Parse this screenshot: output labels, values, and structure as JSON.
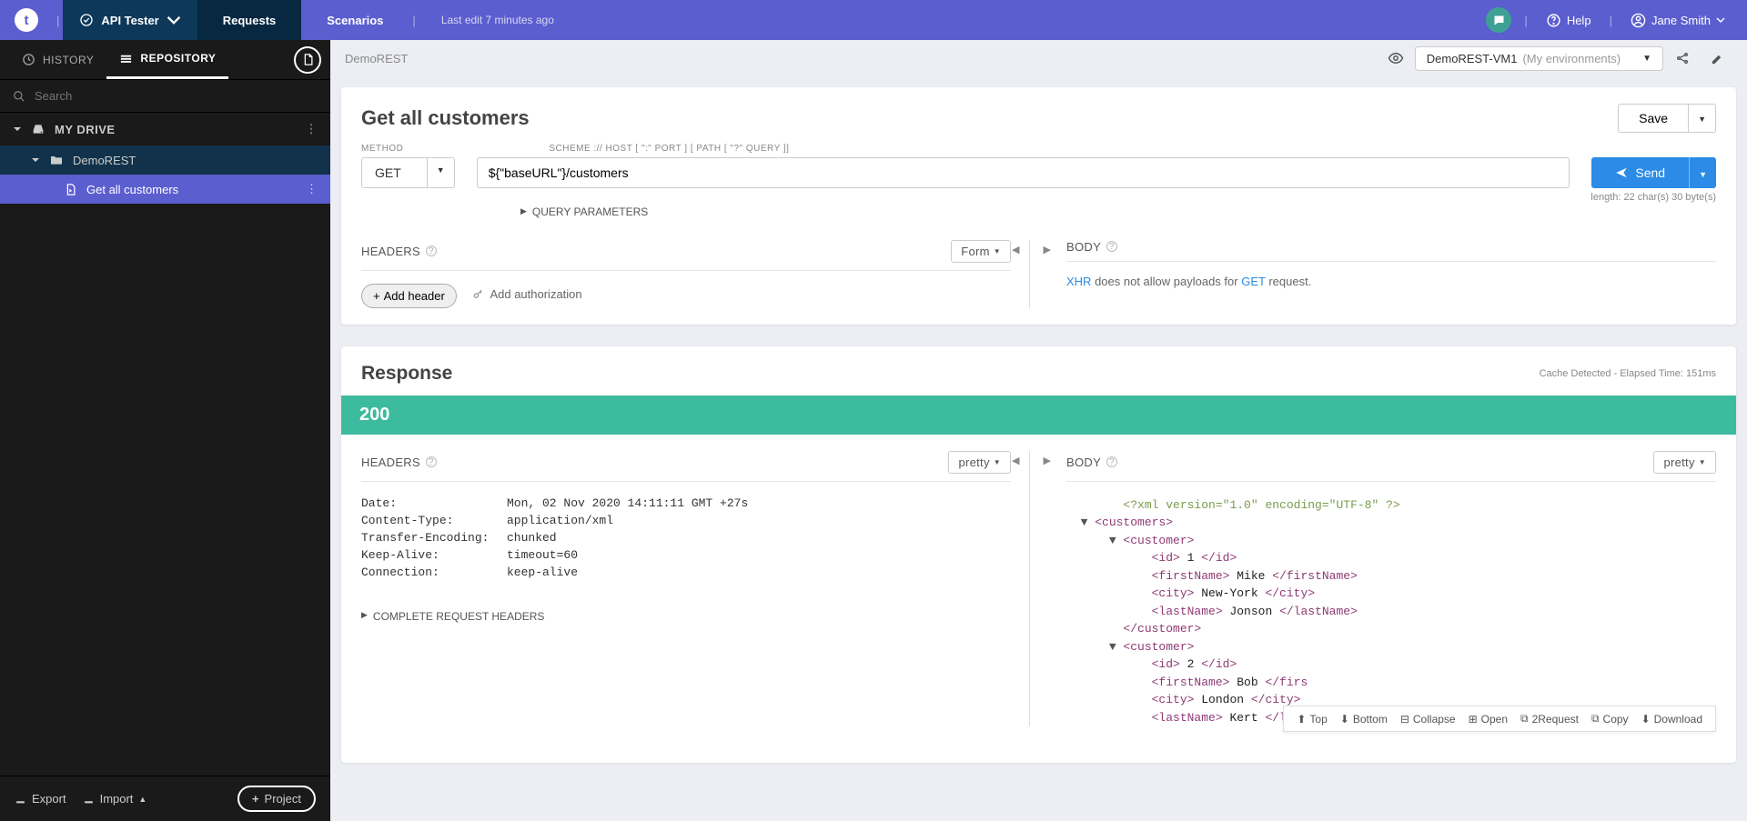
{
  "topbar": {
    "logo_letter": "t",
    "app_name": "API Tester",
    "tabs": {
      "requests": "Requests",
      "scenarios": "Scenarios"
    },
    "last_edit": "Last edit 7 minutes ago",
    "help": "Help",
    "user": "Jane Smith"
  },
  "sidebar": {
    "tabs": {
      "history": "HISTORY",
      "repository": "REPOSITORY"
    },
    "search_placeholder": "Search",
    "drive": "MY DRIVE",
    "project": "DemoREST",
    "request": "Get all customers",
    "footer": {
      "export": "Export",
      "import": "Import",
      "project": "Project"
    }
  },
  "main": {
    "breadcrumb": "DemoREST",
    "env": {
      "name": "DemoREST-VM1",
      "group": "(My environments)"
    }
  },
  "request": {
    "title": "Get all customers",
    "save": "Save",
    "labels": {
      "method": "METHOD",
      "scheme": "SCHEME :// HOST [ \":\" PORT ] [ PATH [ \"?\" QUERY ]]"
    },
    "method": "GET",
    "url": "${\"baseURL\"}/customers",
    "send": "Send",
    "length": "length: 22 char(s) 30 byte(s)",
    "query_params": "QUERY PARAMETERS",
    "headers_label": "HEADERS",
    "headers_format": "Form",
    "add_header": "Add header",
    "add_auth": "Add authorization",
    "body_label": "BODY",
    "body_msg_1": "XHR",
    "body_msg_2": " does not allow payloads for ",
    "body_msg_3": "GET",
    "body_msg_4": " request."
  },
  "response": {
    "title": "Response",
    "meta": "Cache Detected - Elapsed Time: 151ms",
    "status": "200",
    "headers_label": "HEADERS",
    "headers_format": "pretty",
    "body_label": "BODY",
    "body_format": "pretty",
    "headers": [
      {
        "k": "Date:",
        "v": "Mon, 02 Nov 2020 14:11:11 GMT +27s"
      },
      {
        "k": "Content-Type:",
        "v": "application/xml"
      },
      {
        "k": "Transfer-Encoding:",
        "v": "chunked"
      },
      {
        "k": "Keep-Alive:",
        "v": "timeout=60"
      },
      {
        "k": "Connection:",
        "v": "keep-alive"
      }
    ],
    "complete_headers": "COMPLETE REQUEST HEADERS",
    "xml_lines": [
      {
        "indent": 4,
        "pre": "",
        "type": "comment",
        "text": "<?xml version=\"1.0\" encoding=\"UTF-8\" ?>"
      },
      {
        "indent": 2,
        "pre": "▼ ",
        "type": "tag",
        "text": "<customers>"
      },
      {
        "indent": 4,
        "pre": "▼ ",
        "type": "tag",
        "text": "<customer>"
      },
      {
        "indent": 6,
        "pre": "",
        "type": "mixed",
        "open": "<id>",
        "val": " 1 ",
        "close": "</id>"
      },
      {
        "indent": 6,
        "pre": "",
        "type": "mixed",
        "open": "<firstName>",
        "val": " Mike ",
        "close": "</firstName>"
      },
      {
        "indent": 6,
        "pre": "",
        "type": "mixed",
        "open": "<city>",
        "val": " New-York ",
        "close": "</city>"
      },
      {
        "indent": 6,
        "pre": "",
        "type": "mixed",
        "open": "<lastName>",
        "val": " Jonson ",
        "close": "</lastName>"
      },
      {
        "indent": 4,
        "pre": "",
        "type": "tag",
        "text": "</customer>"
      },
      {
        "indent": 4,
        "pre": "▼ ",
        "type": "tag",
        "text": "<customer>"
      },
      {
        "indent": 6,
        "pre": "",
        "type": "mixed",
        "open": "<id>",
        "val": " 2 ",
        "close": "</id>"
      },
      {
        "indent": 6,
        "pre": "",
        "type": "mixed",
        "open": "<firstName>",
        "val": " Bob ",
        "close": "</firs"
      },
      {
        "indent": 6,
        "pre": "",
        "type": "mixed",
        "open": "<city>",
        "val": " London ",
        "close": "</city>"
      },
      {
        "indent": 6,
        "pre": "",
        "type": "mixed",
        "open": "<lastName>",
        "val": " Kert ",
        "close": "</lastName>"
      }
    ],
    "toolbar": {
      "top": "Top",
      "bottom": "Bottom",
      "collapse": "Collapse",
      "open": "Open",
      "torequest": "2Request",
      "copy": "Copy",
      "download": "Download"
    }
  }
}
